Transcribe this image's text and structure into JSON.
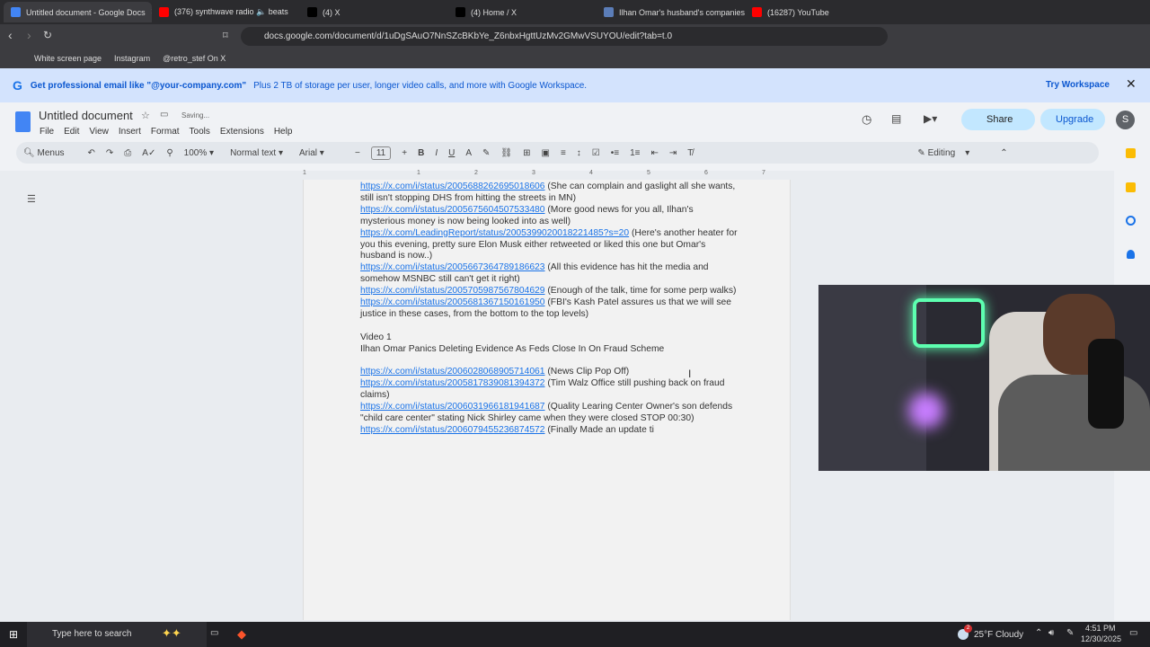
{
  "browser": {
    "tabs": [
      {
        "label": "Untitled document - Google Docs",
        "color": "#4285f4",
        "active": true
      },
      {
        "label": "(376) synthwave radio 🔈 beats",
        "color": "#ff0000"
      },
      {
        "label": "(4) X",
        "color": "#000000"
      },
      {
        "label": "(4) Home / X",
        "color": "#000000"
      },
      {
        "label": "Ilhan Omar's husband's companies s",
        "color": "#5b7db8"
      },
      {
        "label": "(16287) YouTube",
        "color": "#ff0000"
      }
    ],
    "url": "docs.google.com/document/d/1uDgSAuO7NnSZcBKbYe_Z6nbxHgttUzMv2GMwVSUYOU/edit?tab=t.0",
    "bookmarks": [
      "White screen page",
      "Instagram",
      "@retro_stef On X"
    ]
  },
  "banner": {
    "headline": "Get professional email like \"@your-company.com\"",
    "detail": "Plus 2 TB of storage per user, longer video calls, and more with Google Workspace.",
    "cta": "Try Workspace"
  },
  "docs": {
    "title": "Untitled document",
    "status": "Saving...",
    "menus": [
      "File",
      "Edit",
      "View",
      "Insert",
      "Format",
      "Tools",
      "Extensions",
      "Help"
    ],
    "share": "Share",
    "upgrade": "Upgrade",
    "avatar": "S",
    "toolbar": {
      "search": "Menus",
      "zoom": "100%",
      "style": "Normal text",
      "font": "Arial",
      "size": "11",
      "mode": "Editing"
    },
    "ruler": [
      "1",
      "1",
      "2",
      "3",
      "4",
      "5",
      "6",
      "7"
    ]
  },
  "document": {
    "lines": [
      {
        "url": "https://x.com/i/status/2005688262695018606",
        "note": " (She can complain and gaslight all she wants, still isn't stopping DHS from hitting the streets in MN)"
      },
      {
        "url": "https://x.com/i/status/2005675604507533480",
        "note": " (More good news for you all, Ilhan's mysterious money is now being looked into as well)"
      },
      {
        "url": "https://x.com/LeadingReport/status/2005399020018221485?s=20",
        "note": " (Here's another heater for you this evening, pretty sure Elon Musk either retweeted or liked this one but Omar's husband is now..)"
      },
      {
        "url": "https://x.com/i/status/2005667364789186623",
        "note": " (All this evidence has hit the media and somehow MSNBC still can't get it right)"
      },
      {
        "url": "https://x.com/i/status/2005705987567804629",
        "note": " (Enough of the talk, time for some perp walks)"
      },
      {
        "url": "https://x.com/i/status/2005681367150161950",
        "note": " (FBI's Kash Patel assures us that we will see justice in these cases, from the bottom to the top levels)"
      },
      {
        "url": "",
        "note": ""
      },
      {
        "url": "",
        "note": "Video 1"
      },
      {
        "url": "",
        "note": "Ilhan Omar Panics Deleting Evidence As Feds Close In On Fraud Scheme"
      },
      {
        "url": "",
        "note": ""
      },
      {
        "url": "https://x.com/i/status/2006028068905714061",
        "note": " (News Clip Pop Off)"
      },
      {
        "url": "https://x.com/i/status/2005817839081394372",
        "note": " (Tim Walz Office still pushing back on fraud claims)"
      },
      {
        "url": "https://x.com/i/status/2006031966181941687",
        "note": " (Quality Learing Center Owner's son defends \"child care center\" stating Nick Shirley came when they were closed STOP 00:30)"
      },
      {
        "url": "https://x.com/i/status/2006079455236874572",
        "note": " (Finally Made an update ti"
      }
    ]
  },
  "taskbar": {
    "search": "Type here to search",
    "weather": "25°F  Cloudy",
    "time": "4:51 PM",
    "date": "12/30/2025",
    "badge": "2"
  }
}
